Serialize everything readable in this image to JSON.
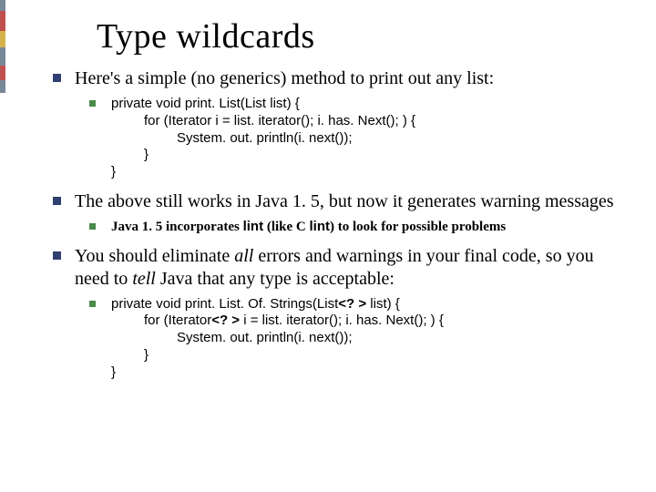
{
  "title": "Type wildcards",
  "p1": "Here's a simple (no generics) method to print out any list:",
  "code1": {
    "l1": "private void print. List(List list) {",
    "l2": "for (Iterator i = list. iterator(); i. has. Next(); ) {",
    "l3": "System. out. println(i. next());",
    "l4": "}",
    "l5": "}"
  },
  "p2": "The above still works in Java 1. 5, but now it generates warning messages",
  "sub2_pre": "Java 1. 5 incorporates ",
  "sub2_lint1": "lint",
  "sub2_mid": " (like C ",
  "sub2_lint2": "lint",
  "sub2_post": ") to look for possible problems",
  "p3_a": "You should eliminate ",
  "p3_all": "all",
  "p3_b": " errors and warnings in your final code, so you need to ",
  "p3_tell": "tell",
  "p3_c": " Java that any type is acceptable:",
  "code2": {
    "l1a": "private void print. List. Of. Strings(List",
    "l1w": "<? >",
    "l1b": " list) {",
    "l2a": "for (Iterator",
    "l2w": "<? >",
    "l2b": " i = list. iterator(); i. has. Next(); ) {",
    "l3": "System. out. println(i. next());",
    "l4": "}",
    "l5": "}"
  }
}
